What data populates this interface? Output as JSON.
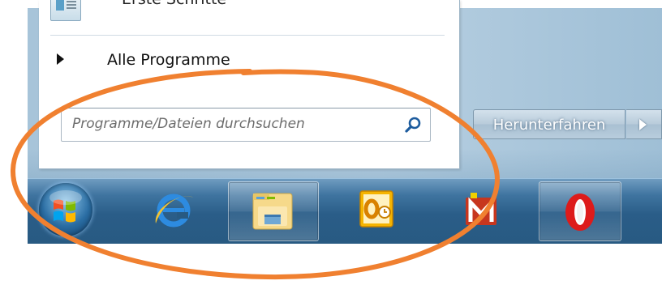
{
  "start_menu": {
    "recent_item_label": "Erste Schritte",
    "all_programs_label": "Alle Programme",
    "search": {
      "placeholder": "Programme/Dateien durchsuchen",
      "value": ""
    }
  },
  "shutdown": {
    "label": "Herunterfahren",
    "options_icon": "triangle-right-icon"
  },
  "taskbar": {
    "items": [
      {
        "name": "start-orb",
        "icon": "windows-logo-icon"
      },
      {
        "name": "internet-explorer",
        "icon": "internet-explorer-icon"
      },
      {
        "name": "windows-explorer",
        "icon": "folder-library-icon"
      },
      {
        "name": "outlook",
        "icon": "outlook-icon"
      },
      {
        "name": "mail-app",
        "icon": "mail-m-icon"
      },
      {
        "name": "opera",
        "icon": "opera-icon"
      }
    ]
  },
  "annotation": {
    "shape": "ellipse",
    "color": "#f08030"
  },
  "colors": {
    "taskbar": "#2a5d88",
    "aero_panel": "#b7cfe1",
    "annotation": "#f08030"
  }
}
